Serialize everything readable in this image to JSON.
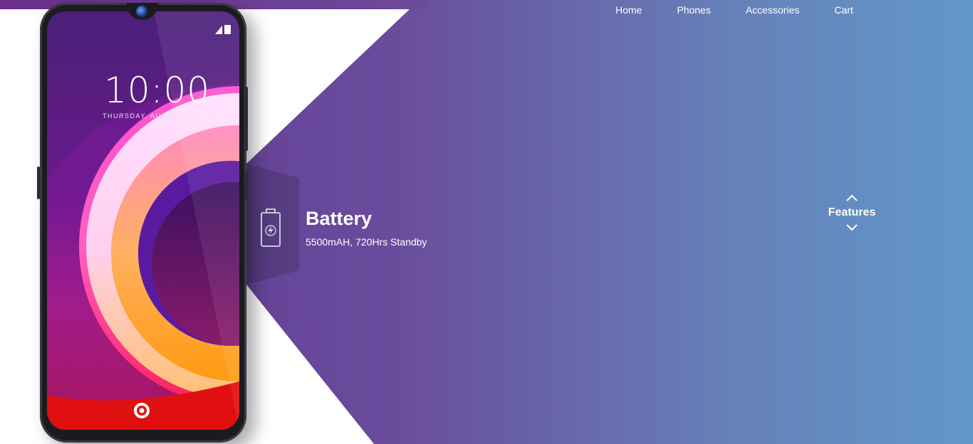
{
  "nav": {
    "items": [
      "Home",
      "Phones",
      "Accessories",
      "Cart"
    ]
  },
  "phone_screen": {
    "time": "10:00",
    "date": "THURSDAY, AUGUST 31"
  },
  "feature": {
    "icon": "battery-icon",
    "title": "Battery",
    "description": "5500mAH, 720Hrs Standby"
  },
  "features_nav": {
    "label": "Features",
    "up_icon": "chevron-up-icon",
    "down_icon": "chevron-down-icon"
  },
  "colors": {
    "gradient_left": "#5e3a92",
    "gradient_right": "#6298c8",
    "text": "#ffffff"
  }
}
